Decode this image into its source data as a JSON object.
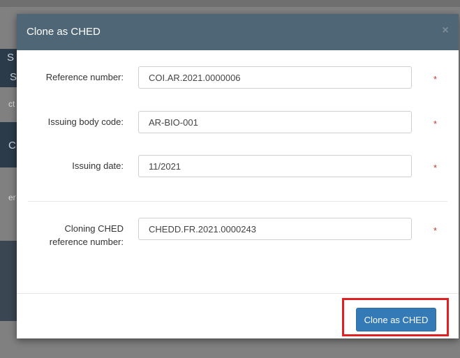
{
  "modal": {
    "title": "Clone as CHED",
    "close_glyph": "×"
  },
  "fields": {
    "reference_number": {
      "label": "Reference number:",
      "value": "COI.AR.2021.0000006",
      "required_mark": "*"
    },
    "issuing_body_code": {
      "label": "Issuing body code:",
      "value": "AR-BIO-001",
      "required_mark": "*"
    },
    "issuing_date": {
      "label": "Issuing date:",
      "value": "11/2021",
      "required_mark": "*"
    },
    "cloning_ched_ref": {
      "label_line1": "Cloning CHED",
      "label_line2": "reference number:",
      "value": "CHEDD.FR.2021.0000243",
      "required_mark": "*"
    }
  },
  "footer": {
    "clone_button_label": "Clone as CHED"
  },
  "background": {
    "partial_letters": [
      "S",
      "S",
      "C",
      "ct",
      "er"
    ]
  },
  "colors": {
    "header_bg": "#4f6676",
    "primary_button": "#337ab7",
    "required": "#c0392b",
    "highlight": "#e02020"
  }
}
